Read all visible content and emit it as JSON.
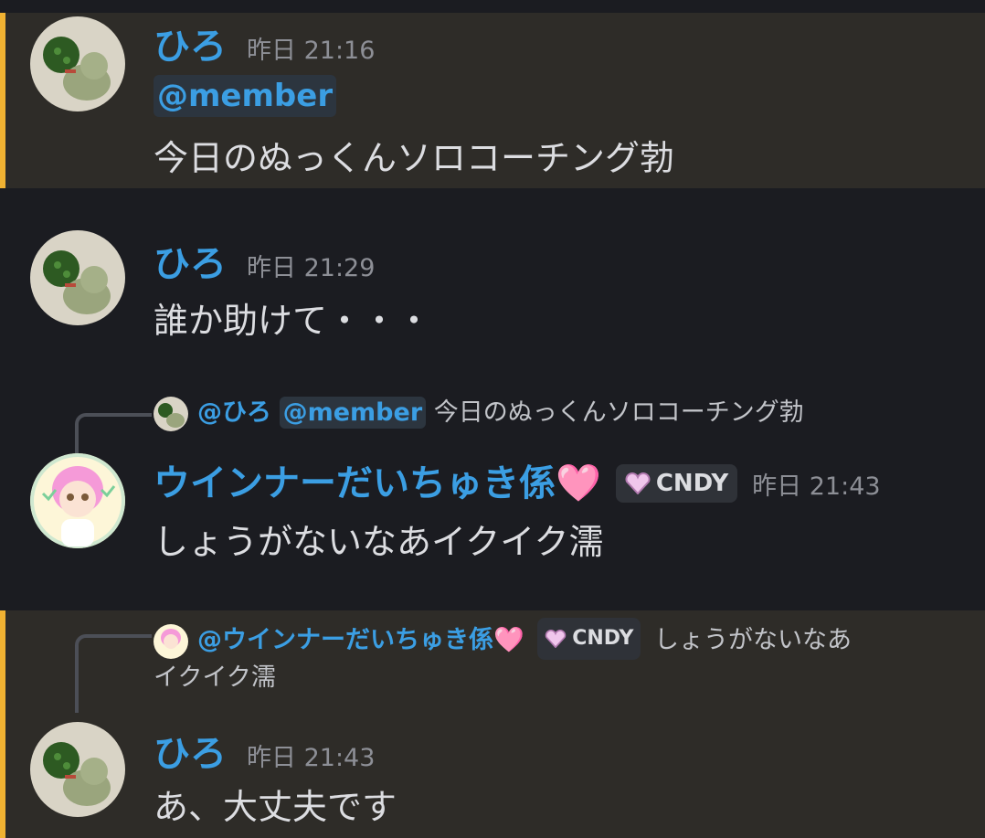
{
  "messages": [
    {
      "user": "ひろ",
      "time": "昨日 21:16",
      "mention": "@member",
      "text": "今日のぬっくんソロコーチング勃"
    },
    {
      "user": "ひろ",
      "time": "昨日 21:29",
      "text": "誰か助けて・・・"
    },
    {
      "reply": {
        "user": "@ひろ",
        "mention": "@member",
        "text": "今日のぬっくんソロコーチング勃"
      },
      "user": "ウインナーだいちゅき係",
      "user_emoji": "🩷",
      "tag": "CNDY",
      "time": "昨日 21:43",
      "text": "しょうがないなあイクイク濡"
    },
    {
      "reply": {
        "user": "@ウインナーだいちゅき係",
        "user_emoji": "🩷",
        "tag": "CNDY",
        "text_line1": "しょうがないなあ",
        "text_line2": "イクイク濡"
      },
      "user": "ひろ",
      "time": "昨日 21:43",
      "text": "あ、大丈夫です"
    }
  ],
  "colors": {
    "background": "#1b1c21",
    "highlight_background": "#2e2c28",
    "highlight_border": "#f0b232",
    "username": "#3b9ee3",
    "timestamp": "#8d8f96",
    "text": "#dcdde1"
  }
}
